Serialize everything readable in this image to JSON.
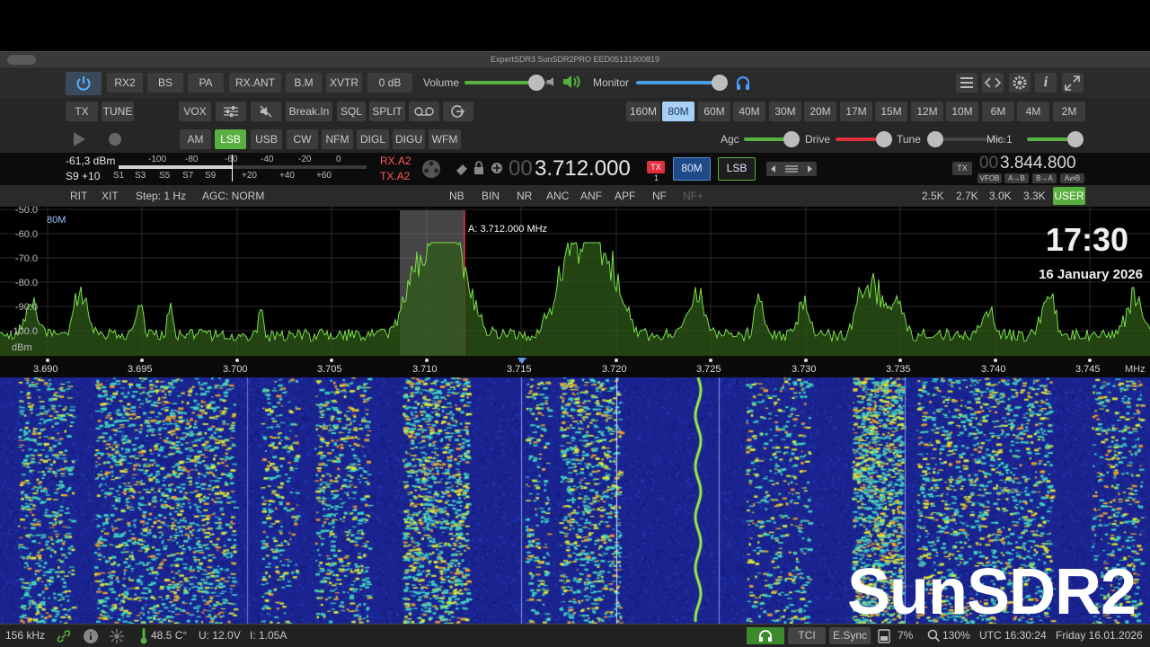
{
  "window": {
    "title": "ExpertSDR3 SunSDR2PRO EED05131900819"
  },
  "row1": {
    "buttons": [
      "RX2",
      "BS",
      "PA",
      "RX.ANT",
      "B.M",
      "XVTR",
      "0 dB"
    ],
    "volume_label": "Volume",
    "monitor_label": "Monitor"
  },
  "row2": {
    "tx": "TX",
    "tune": "TUNE",
    "vox": "VOX",
    "breakin": "Break.In",
    "sql": "SQL",
    "split": "SPLIT",
    "bands": [
      "160M",
      "80M",
      "60M",
      "40M",
      "30M",
      "20M",
      "17M",
      "15M",
      "12M",
      "10M",
      "6M",
      "4M",
      "2M"
    ],
    "active_band": "80M"
  },
  "row3": {
    "modes": [
      "AM",
      "LSB",
      "USB",
      "CW",
      "NFM",
      "DIGL",
      "DIGU",
      "WFM"
    ],
    "active_mode": "LSB",
    "agc_label": "Agc",
    "drive_label": "Drive",
    "tune_label": "Tune",
    "mic_label": "Mic.1"
  },
  "row4": {
    "dbm": "-61,3 dBm",
    "s_reading": "S9 +10",
    "scale_top": [
      "-100",
      "-80",
      "-60",
      "-40",
      "-20",
      "0"
    ],
    "scale_bottom": [
      "S1",
      "S3",
      "S5",
      "S7",
      "S9",
      "+20",
      "+40",
      "+60"
    ],
    "rx_ant": "RX.A2",
    "tx_ant": "TX.A2",
    "vfoa_prefix": "00",
    "vfoa": "3.712.000",
    "tx_badge": "TX",
    "tx_num": "1",
    "band_badge": "80M",
    "mode_badge": "LSB",
    "tx_small": "TX",
    "vfob_prefix": "00",
    "vfob": "3.844.800",
    "vfob_btns": [
      "VFOB",
      "A→B",
      "B→A",
      "A⇄B"
    ]
  },
  "row5": {
    "rit": "RIT",
    "xit": "XIT",
    "step": "Step: 1 Hz",
    "agc": "AGC: NORM",
    "dsp": [
      "NB",
      "BIN",
      "NR",
      "ANC",
      "ANF",
      "APF",
      "NF",
      "NF+"
    ],
    "filters": [
      "2.5K",
      "2.7K",
      "3.0K",
      "3.3K",
      "USER"
    ],
    "active_filter": "USER"
  },
  "spectrum": {
    "band_label": "80M",
    "db_labels": [
      "-50.0",
      "-60.0",
      "-70.0",
      "-80.0",
      "-90.0",
      "-100.0"
    ],
    "unit": "dBm",
    "marker": "A: 3.712.000 MHz",
    "freq_ticks": [
      "3.690",
      "3.695",
      "3.700",
      "3.705",
      "3.710",
      "3.715",
      "3.720",
      "3.725",
      "3.730",
      "3.735",
      "3.740",
      "3.745"
    ],
    "freq_unit": "MHz"
  },
  "overlay": {
    "time": "17:30",
    "date": "16 January 2026",
    "brand": "SunSDR2"
  },
  "status": {
    "span": "156 kHz",
    "temp": "48.5 C°",
    "voltage": "U: 12.0V",
    "current": "I: 1.05A",
    "tci": "TCI",
    "esync": "E.Sync",
    "cpu": "7%",
    "zoom": "130%",
    "utc": "UTC 16:30:24",
    "local": "Friday 16.01.2026"
  },
  "colors": {
    "accent_green": "#58b040",
    "accent_blue": "#a8cff5",
    "spectrum_green": "#7be04a",
    "tx_red": "#e03040"
  }
}
